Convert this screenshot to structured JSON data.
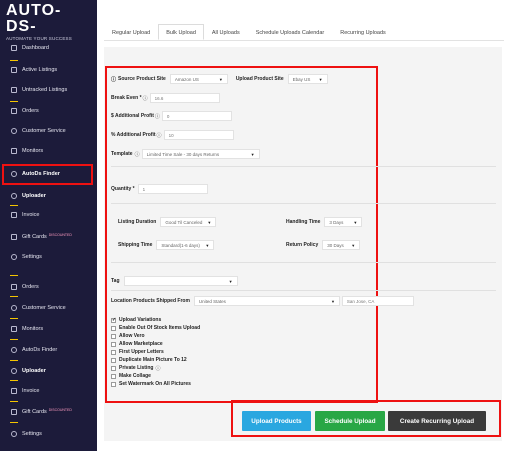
{
  "brand": {
    "title": "AUTO-DS-",
    "subtitle": "AUTOMATE YOUR SUCCESS"
  },
  "sidebar": {
    "items": [
      {
        "label": "Dashboard",
        "icon": "dashboard-icon"
      },
      {
        "label": "Active Listings",
        "icon": "list-icon"
      },
      {
        "label": "Untracked Listings",
        "icon": "list-icon"
      },
      {
        "label": "Orders",
        "icon": "orders-icon"
      },
      {
        "label": "Customer Service",
        "icon": "heart-icon"
      },
      {
        "label": "Monitors",
        "icon": "monitor-icon"
      },
      {
        "label": "AutoDs Finder",
        "icon": "search-icon"
      },
      {
        "label": "Uploader",
        "icon": "upload-icon"
      },
      {
        "label": "Invoice",
        "icon": "invoice-icon"
      },
      {
        "label": "Gift Cards",
        "icon": "gift-icon",
        "badge": "DISCOUNTED"
      },
      {
        "label": "Settings",
        "icon": "settings-icon"
      },
      {
        "label": "Orders",
        "icon": "orders-icon"
      },
      {
        "label": "Customer Service",
        "icon": "heart-icon"
      },
      {
        "label": "Monitors",
        "icon": "monitor-icon"
      },
      {
        "label": "AutoDs Finder",
        "icon": "search-icon"
      },
      {
        "label": "Uploader",
        "icon": "upload-icon"
      },
      {
        "label": "Invoice",
        "icon": "invoice-icon"
      },
      {
        "label": "Gift Cards",
        "icon": "gift-icon",
        "badge": "DISCOUNTED"
      },
      {
        "label": "Settings",
        "icon": "settings-icon"
      }
    ]
  },
  "tabs": [
    "Regular Upload",
    "Bulk Upload",
    "All Uploads",
    "Schedule Uploads Calendar",
    "Recurring Uploads"
  ],
  "form": {
    "source_site_label": "Source Product Site",
    "source_site_value": "Amazon US",
    "upload_site_label": "Upload Product Site",
    "upload_site_value": "Ebay US",
    "break_even_label": "Break Even *",
    "break_even_value": "16.6",
    "add_profit_label": "$ Additional Profit",
    "add_profit_value": "0",
    "pct_profit_label": "% Additional Profit",
    "pct_profit_value": "10",
    "template_label": "Template",
    "template_value": "Limited Time Sale - 30 days Returns",
    "quantity_label": "Quantity *",
    "quantity_value": "1",
    "listing_duration_label": "Listing Duration",
    "listing_duration_value": "Good Til Canceled",
    "handling_time_label": "Handling Time",
    "handling_time_value": "3 Days",
    "shipping_time_label": "Shipping Time",
    "shipping_time_value": "Standard(1-6 days)",
    "return_policy_label": "Return Policy",
    "return_policy_value": "30 Days",
    "tag_label": "Tag",
    "location_label": "Location Products Shipped From",
    "location_country": "United States",
    "location_city": "San Jose, CA"
  },
  "checkboxes": [
    {
      "label": "Upload Variations",
      "checked": true,
      "help": false
    },
    {
      "label": "Enable Out Of Stock Items Upload",
      "checked": false,
      "help": false
    },
    {
      "label": "Allow Vero",
      "checked": false,
      "help": false
    },
    {
      "label": "Allow Marketplace",
      "checked": false,
      "help": false
    },
    {
      "label": "First Upper Letters",
      "checked": false,
      "help": false
    },
    {
      "label": "Duplicate Main Picture To 12",
      "checked": false,
      "help": false
    },
    {
      "label": "Private Listing",
      "checked": false,
      "help": true
    },
    {
      "label": "Make Collage",
      "checked": false,
      "help": false
    },
    {
      "label": "Set Watermark On All Pictures",
      "checked": false,
      "help": false
    }
  ],
  "buttons": {
    "upload": "Upload Products",
    "schedule": "Schedule Upload",
    "recurring": "Create Recurring Upload"
  },
  "colors": {
    "sidebar": "#1c1b3a",
    "highlight": "#e11111",
    "upload_button": "#2aa7e0",
    "schedule_button": "#28a745",
    "recurring_button": "#3a3a3a"
  }
}
